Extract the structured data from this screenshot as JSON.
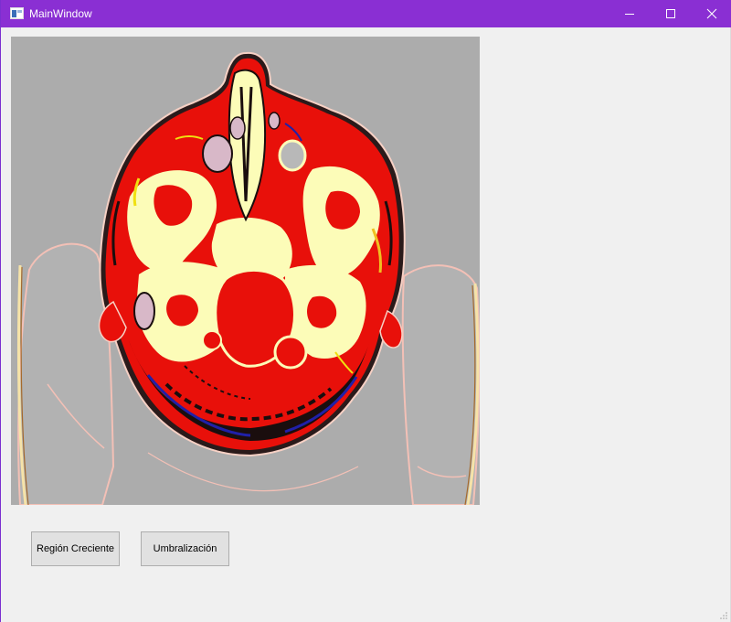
{
  "window": {
    "title": "MainWindow",
    "accent_color": "#8a2fd3",
    "controls": [
      "minimize-icon",
      "maximize-icon",
      "close-icon"
    ]
  },
  "viewer": {
    "content": "axial-head-scan-false-color"
  },
  "buttons": {
    "region_growing": "Región Creciente",
    "thresholding": "Umbralización"
  }
}
